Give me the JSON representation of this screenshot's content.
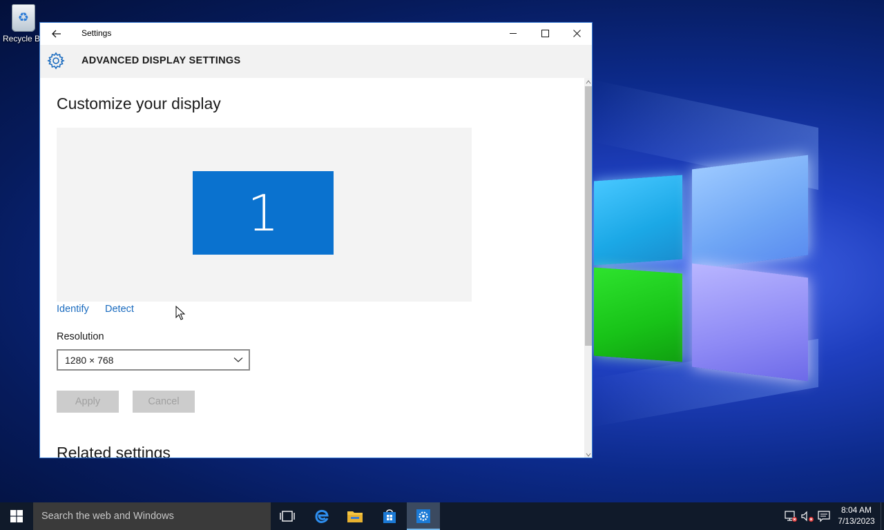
{
  "desktop": {
    "recycle_bin_label": "Recycle Bin"
  },
  "window": {
    "title": "Settings",
    "section_title": "ADVANCED DISPLAY SETTINGS"
  },
  "content": {
    "heading": "Customize your display",
    "monitor_number": "1",
    "identify_label": "Identify",
    "detect_label": "Detect",
    "resolution_label": "Resolution",
    "resolution_value": "1280 × 768",
    "apply_label": "Apply",
    "cancel_label": "Cancel",
    "related_heading": "Related settings"
  },
  "taskbar": {
    "search_placeholder": "Search the web and Windows",
    "time": "8:04 AM",
    "date": "7/13/2023",
    "icons": [
      "windows-start-icon",
      "task-view-icon",
      "edge-icon",
      "file-explorer-icon",
      "store-icon",
      "settings-gear-icon",
      "network-icon",
      "volume-icon",
      "action-center-icon"
    ]
  },
  "colors": {
    "accent": "#0a72cf",
    "link": "#1a6bbf",
    "header_band": "#f2f2f2",
    "taskbar": "#101a2a"
  }
}
